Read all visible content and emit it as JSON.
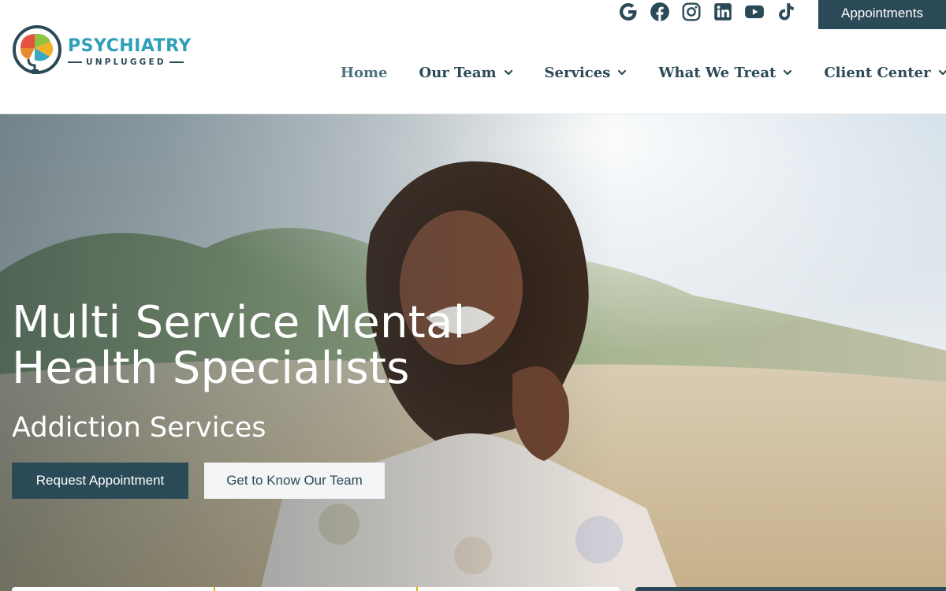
{
  "brand": {
    "name_line1": "PSYCHIATRY",
    "name_line2": "UNPLUGGED",
    "colors": {
      "primary": "#2b4a57",
      "accent": "#2f9fb8",
      "divider": "#d9b21c"
    }
  },
  "header": {
    "socials": [
      {
        "icon": "google-icon",
        "label": "Google"
      },
      {
        "icon": "facebook-icon",
        "label": "Facebook"
      },
      {
        "icon": "instagram-icon",
        "label": "Instagram"
      },
      {
        "icon": "linkedin-icon",
        "label": "LinkedIn"
      },
      {
        "icon": "youtube-icon",
        "label": "YouTube"
      },
      {
        "icon": "tiktok-icon",
        "label": "TikTok"
      }
    ],
    "appointments_label": "Appointments"
  },
  "nav": {
    "items": [
      {
        "label": "Home",
        "has_dropdown": false,
        "active": true
      },
      {
        "label": "Our Team",
        "has_dropdown": true
      },
      {
        "label": "Services",
        "has_dropdown": true
      },
      {
        "label": "What We Treat",
        "has_dropdown": true
      },
      {
        "label": "Client Center",
        "has_dropdown": true
      }
    ]
  },
  "hero": {
    "title": "Multi Service Mental Health Specialists",
    "subtitle": "Addiction Services",
    "primary_button": "Request Appointment",
    "secondary_button": "Get to Know Our Team"
  }
}
